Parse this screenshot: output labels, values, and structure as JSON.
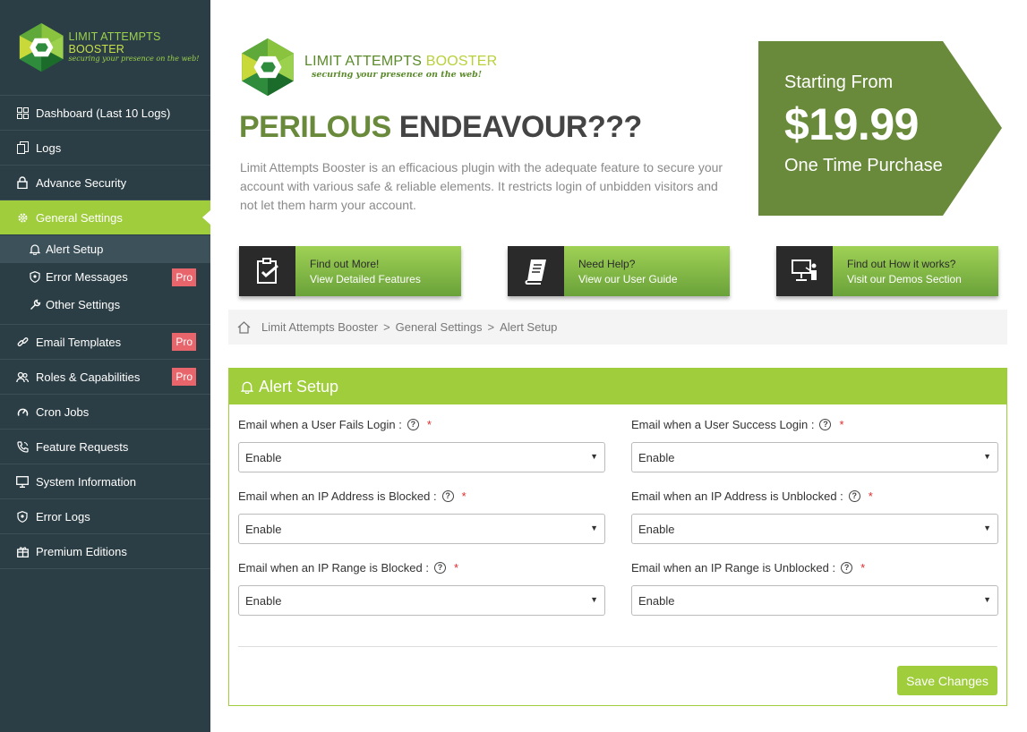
{
  "brand": {
    "name_part1": "LIMIT ATTEMPTS ",
    "name_part2": "BOOSTER",
    "tagline": "securing your presence on the web!"
  },
  "sidebar": {
    "items": [
      {
        "label": "Dashboard (Last 10 Logs)",
        "icon": "dashboard-icon"
      },
      {
        "label": "Logs",
        "icon": "logs-icon"
      },
      {
        "label": "Advance Security",
        "icon": "lock-icon"
      },
      {
        "label": "General Settings",
        "icon": "gear-icon",
        "active": true
      },
      {
        "label": "Email Templates",
        "icon": "link-icon",
        "badge": "Pro"
      },
      {
        "label": "Roles & Capabilities",
        "icon": "users-icon",
        "badge": "Pro"
      },
      {
        "label": "Cron Jobs",
        "icon": "gauge-icon"
      },
      {
        "label": "Feature Requests",
        "icon": "phone-icon"
      },
      {
        "label": "System Information",
        "icon": "monitor-icon"
      },
      {
        "label": "Error Logs",
        "icon": "shield-icon"
      },
      {
        "label": "Premium Editions",
        "icon": "gift-icon"
      }
    ],
    "submenu": [
      {
        "label": "Alert Setup",
        "icon": "bell-icon",
        "active": true
      },
      {
        "label": "Error Messages",
        "icon": "shield-icon",
        "badge": "Pro"
      },
      {
        "label": "Other Settings",
        "icon": "wrench-icon"
      }
    ]
  },
  "hero": {
    "heading_word1": "PERILOUS",
    "heading_word2": "ENDEAVOUR???",
    "description": "Limit Attempts Booster is an efficacious plugin with the adequate feature to secure your account with various safe & reliable elements. It restricts login of unbidden visitors and not let them harm your account."
  },
  "price": {
    "from": "Starting From",
    "amount": "$19.99",
    "once": "One Time Purchase"
  },
  "promos": [
    {
      "line1": "Find out More!",
      "line2": "View Detailed Features",
      "icon": "clipboard-check-icon"
    },
    {
      "line1": "Need Help?",
      "line2": "View our User Guide",
      "icon": "book-icon"
    },
    {
      "line1": "Find out How it works?",
      "line2": "Visit our Demos Section",
      "icon": "presentation-icon"
    }
  ],
  "breadcrumb": {
    "items": [
      "Limit Attempts Booster",
      "General Settings",
      "Alert Setup"
    ],
    "separator": ">"
  },
  "panel": {
    "title": "Alert Setup",
    "fields": [
      {
        "label": "Email when a User Fails Login :",
        "value": "Enable"
      },
      {
        "label": "Email when a User Success Login :",
        "value": "Enable"
      },
      {
        "label": "Email when an IP Address is Blocked :",
        "value": "Enable"
      },
      {
        "label": "Email when an IP Address is Unblocked :",
        "value": "Enable"
      },
      {
        "label": "Email when an IP Range is Blocked :",
        "value": "Enable"
      },
      {
        "label": "Email when an IP Range is Unblocked :",
        "value": "Enable"
      }
    ],
    "help_glyph": "?",
    "required_mark": "*",
    "save_label": "Save Changes"
  },
  "colors": {
    "sidebar_bg": "#2c3e45",
    "accent": "#9fcd3b",
    "price_bg": "#6a8a3b",
    "pro_badge": "#e8656b"
  }
}
